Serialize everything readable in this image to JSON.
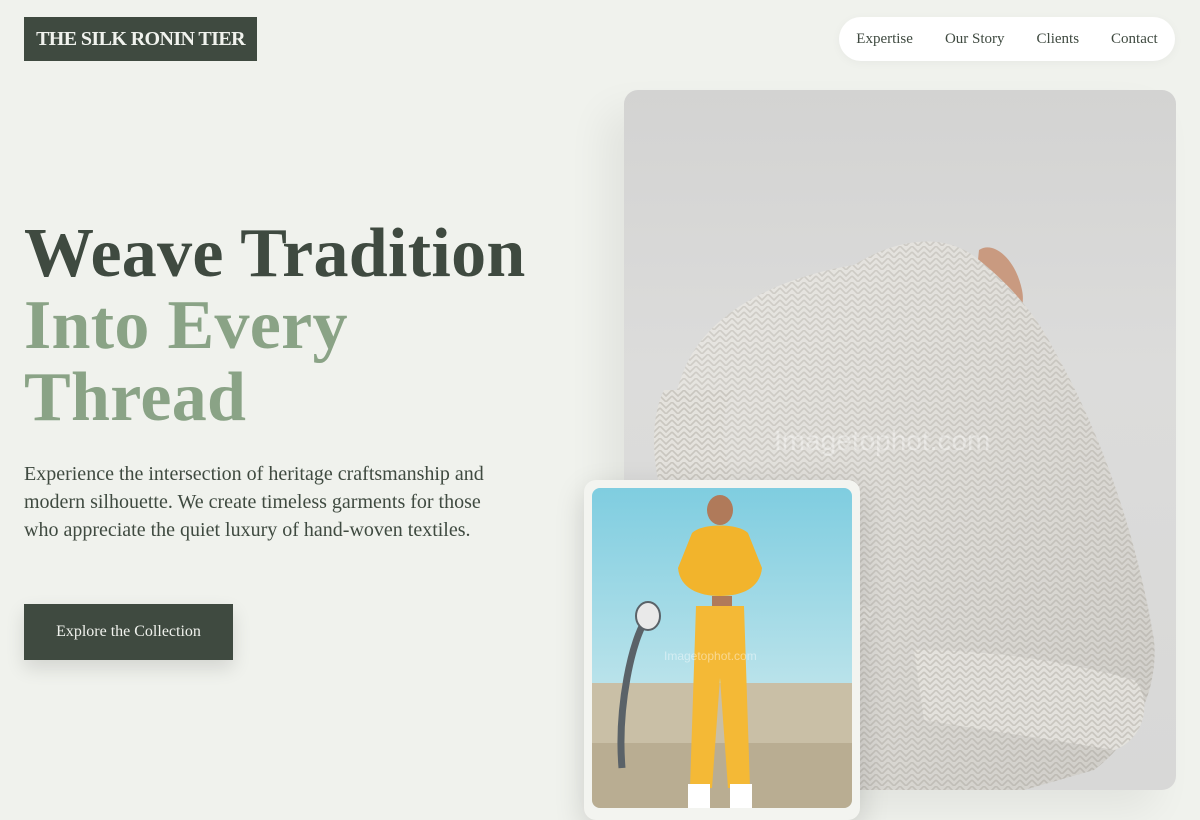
{
  "brand": {
    "name": "THE SILK RONIN TIER"
  },
  "nav": {
    "items": [
      {
        "label": "Expertise"
      },
      {
        "label": "Our Story"
      },
      {
        "label": "Clients"
      },
      {
        "label": "Contact"
      }
    ]
  },
  "hero": {
    "headline_line1": "Weave Tradition",
    "headline_line2a": "Into Every",
    "headline_line2b": "Thread",
    "description": "Experience the intersection of heritage craftsmanship and modern silhouette. We create timeless garments for those who appreciate the quiet luxury of hand-woven textiles.",
    "cta_label": "Explore the Collection"
  },
  "images": {
    "main": {
      "subject": "person-in-white-knit-sweater",
      "watermark": "Imagetophot.com"
    },
    "inset": {
      "subject": "woman-in-yellow-tracksuit-basketball-court",
      "watermark": "Imagetophot.com"
    }
  },
  "colors": {
    "background": "#f0f2ed",
    "primary_dark": "#3f4a40",
    "accent_sage": "#8aa386",
    "nav_bg": "#ffffff"
  }
}
